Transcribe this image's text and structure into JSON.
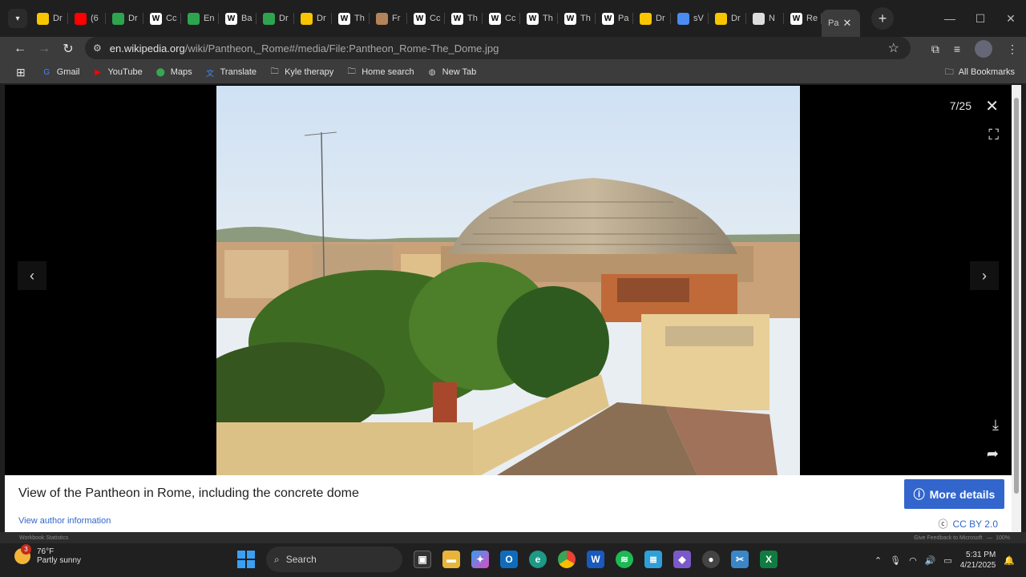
{
  "browser": {
    "tabs": [
      {
        "label": "Dr",
        "icon": "yellow-doc-icon",
        "color": "#f7c600"
      },
      {
        "label": "(6",
        "icon": "youtube-icon",
        "color": "#ff0000"
      },
      {
        "label": "Dr",
        "icon": "globe-icon",
        "color": "#2ea44f"
      },
      {
        "label": "Cc",
        "icon": "wikipedia-icon",
        "color": "#ffffff"
      },
      {
        "label": "En",
        "icon": "globe-icon",
        "color": "#2ea44f"
      },
      {
        "label": "Ba",
        "icon": "wikipedia-icon",
        "color": "#ffffff"
      },
      {
        "label": "Dr",
        "icon": "globe-icon",
        "color": "#2ea44f"
      },
      {
        "label": "Dr",
        "icon": "yellow-doc-icon",
        "color": "#f7c600"
      },
      {
        "label": "Th",
        "icon": "wikipedia-icon",
        "color": "#ffffff"
      },
      {
        "label": "Fr",
        "icon": "photo-icon",
        "color": "#b5835a"
      },
      {
        "label": "Cc",
        "icon": "wikipedia-icon",
        "color": "#ffffff"
      },
      {
        "label": "Th",
        "icon": "wikipedia-icon",
        "color": "#ffffff"
      },
      {
        "label": "Cc",
        "icon": "wikipedia-icon",
        "color": "#ffffff"
      },
      {
        "label": "Th",
        "icon": "wikipedia-icon",
        "color": "#ffffff"
      },
      {
        "label": "Th",
        "icon": "wikipedia-icon",
        "color": "#ffffff"
      },
      {
        "label": "Pa",
        "icon": "wikipedia-icon",
        "color": "#ffffff"
      },
      {
        "label": "Dr",
        "icon": "yellow-doc-icon",
        "color": "#f7c600"
      },
      {
        "label": "sV",
        "icon": "chart-icon",
        "color": "#4a8cf0"
      },
      {
        "label": "Dr",
        "icon": "yellow-doc-icon",
        "color": "#f7c600"
      },
      {
        "label": "N",
        "icon": "doc-icon",
        "color": "#dddddd"
      },
      {
        "label": "Re",
        "icon": "wikipedia-icon",
        "color": "#ffffff"
      }
    ],
    "active_tab": {
      "label": "Pa"
    },
    "url_site": "en.wikipedia.org",
    "url_path": "/wiki/Pantheon,_Rome#/media/File:Pantheon_Rome-The_Dome.jpg"
  },
  "bookmarks": [
    {
      "label": "Gmail",
      "icon": "google-icon"
    },
    {
      "label": "YouTube",
      "icon": "youtube-icon"
    },
    {
      "label": "Maps",
      "icon": "maps-pin-icon"
    },
    {
      "label": "Translate",
      "icon": "translate-icon"
    },
    {
      "label": "Kyle therapy",
      "icon": "folder-icon"
    },
    {
      "label": "Home search",
      "icon": "folder-icon"
    },
    {
      "label": "New Tab",
      "icon": "globe-icon"
    }
  ],
  "all_bookmarks": "All Bookmarks",
  "viewer": {
    "counter": "7/25",
    "caption": "View of the Pantheon in Rome, including the concrete dome",
    "author_link": "View author information",
    "more_details": "More details",
    "license": "CC BY 2.0"
  },
  "status_strip": {
    "left": "Workbook Statistics",
    "right": "Give Feedback to Microsoft",
    "zoom": "100%"
  },
  "taskbar": {
    "weather_temp": "76°F",
    "weather_desc": "Partly sunny",
    "notification_count": "3",
    "search_placeholder": "Search",
    "time": "5:31 PM",
    "date": "4/21/2025"
  }
}
